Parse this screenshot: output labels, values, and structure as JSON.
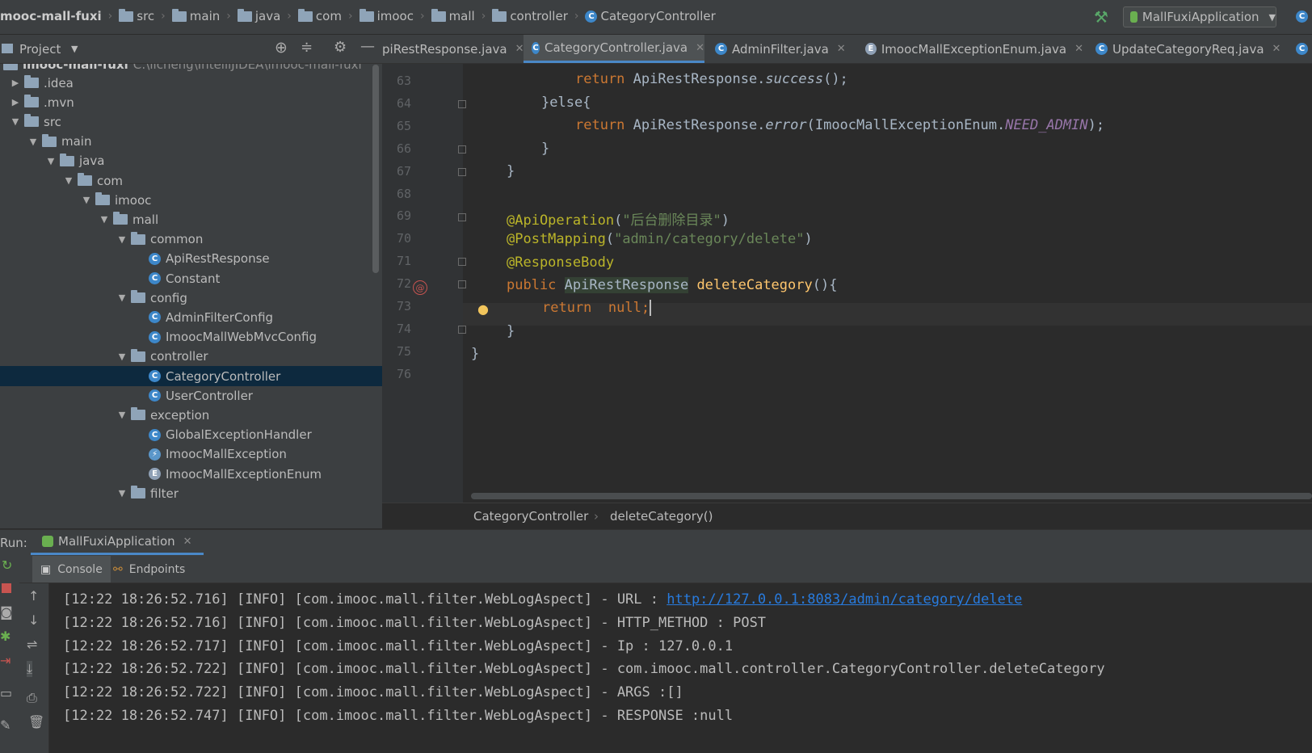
{
  "navbar": {
    "project": "mooc-mall-fuxi",
    "crumbs": [
      "src",
      "main",
      "java",
      "com",
      "imooc",
      "mall",
      "controller",
      "CategoryController"
    ],
    "run_config": "MallFuxiApplication"
  },
  "project_panel": {
    "title": "Project",
    "root_label": "imooc-mall-fuxi",
    "root_path": "C:\\licheng\\IntelliJIDEA\\imooc-mall-fuxi",
    "tree": [
      {
        "label": ".idea",
        "type": "folder",
        "depth": 1,
        "arrow": "right"
      },
      {
        "label": ".mvn",
        "type": "folder",
        "depth": 1,
        "arrow": "right"
      },
      {
        "label": "src",
        "type": "folder",
        "depth": 1,
        "arrow": "down"
      },
      {
        "label": "main",
        "type": "folder",
        "depth": 2,
        "arrow": "down"
      },
      {
        "label": "java",
        "type": "folder",
        "depth": 3,
        "arrow": "down"
      },
      {
        "label": "com",
        "type": "folder",
        "depth": 4,
        "arrow": "down"
      },
      {
        "label": "imooc",
        "type": "folder",
        "depth": 5,
        "arrow": "down"
      },
      {
        "label": "mall",
        "type": "folder",
        "depth": 6,
        "arrow": "down"
      },
      {
        "label": "common",
        "type": "folder",
        "depth": 7,
        "arrow": "down"
      },
      {
        "label": "ApiRestResponse",
        "type": "class",
        "depth": 8
      },
      {
        "label": "Constant",
        "type": "class",
        "depth": 8
      },
      {
        "label": "config",
        "type": "folder",
        "depth": 7,
        "arrow": "down"
      },
      {
        "label": "AdminFilterConfig",
        "type": "class",
        "depth": 8
      },
      {
        "label": "ImoocMallWebMvcConfig",
        "type": "class",
        "depth": 8
      },
      {
        "label": "controller",
        "type": "folder",
        "depth": 7,
        "arrow": "down"
      },
      {
        "label": "CategoryController",
        "type": "class",
        "depth": 8,
        "selected": true
      },
      {
        "label": "UserController",
        "type": "class",
        "depth": 8
      },
      {
        "label": "exception",
        "type": "folder",
        "depth": 7,
        "arrow": "down"
      },
      {
        "label": "GlobalExceptionHandler",
        "type": "class",
        "depth": 8
      },
      {
        "label": "ImoocMallException",
        "type": "exception",
        "depth": 8
      },
      {
        "label": "ImoocMallExceptionEnum",
        "type": "enum",
        "depth": 8
      },
      {
        "label": "filter",
        "type": "folder",
        "depth": 7,
        "arrow": "down"
      }
    ]
  },
  "editor_tabs": [
    {
      "label": "piRestResponse.java",
      "icon": "none"
    },
    {
      "label": "CategoryController.java",
      "icon": "C",
      "active": true
    },
    {
      "label": "AdminFilter.java",
      "icon": "C"
    },
    {
      "label": "ImoocMallExceptionEnum.java",
      "icon": "E"
    },
    {
      "label": "UpdateCategoryReq.java",
      "icon": "C"
    }
  ],
  "editor": {
    "line_numbers": [
      "63",
      "64",
      "65",
      "66",
      "67",
      "68",
      "69",
      "70",
      "71",
      "72",
      "73",
      "74",
      "75",
      "76"
    ],
    "breadcrumb": [
      "CategoryController",
      "deleteCategory()"
    ]
  },
  "run_panel": {
    "label": "Run:",
    "app": "MallFuxiApplication",
    "tabs": [
      "Console",
      "Endpoints"
    ],
    "log_prefix": "[12:22 18:26:52.",
    "logs": [
      {
        "time": "716",
        "msg": " - URL : ",
        "link": "http://127.0.0.1:8083/admin/category/delete"
      },
      {
        "time": "716",
        "msg": " - HTTP_METHOD : POST"
      },
      {
        "time": "717",
        "msg": " - Ip : 127.0.0.1"
      },
      {
        "time": "722",
        "msg": " - com.imooc.mall.controller.CategoryController.deleteCategory"
      },
      {
        "time": "722",
        "msg": " - ARGS :[]"
      },
      {
        "time": "747",
        "msg": " - RESPONSE :null"
      }
    ],
    "log_level": "[INFO]",
    "log_logger": "[com.imooc.mall.filter.WebLogAspect]"
  },
  "code": {
    "l63_a": "return ",
    "l63_b": "ApiRestResponse.",
    "l63_c": "success",
    "l63_d": "();",
    "l64": "}else{",
    "l65_a": "return ",
    "l65_b": "ApiRestResponse.",
    "l65_c": "error",
    "l65_d": "(ImoocMallExceptionEnum.",
    "l65_e": "NEED_ADMIN",
    "l65_f": ");",
    "l66": "}",
    "l67": "}",
    "l69_a": "@ApiOperation",
    "l69_b": "(",
    "l69_c": "\"后台删除目录\"",
    "l69_d": ")",
    "l70_a": "@PostMapping",
    "l70_b": "(",
    "l70_c": "\"admin/category/delete\"",
    "l70_d": ")",
    "l71": "@ResponseBody",
    "l72_a": "public ",
    "l72_b": "ApiRestResponse",
    "l72_c": " ",
    "l72_d": "deleteCategory",
    "l72_e": "(){",
    "l73_a": "return  ",
    "l73_b": "null;",
    "l74": "}",
    "l75": "}"
  }
}
